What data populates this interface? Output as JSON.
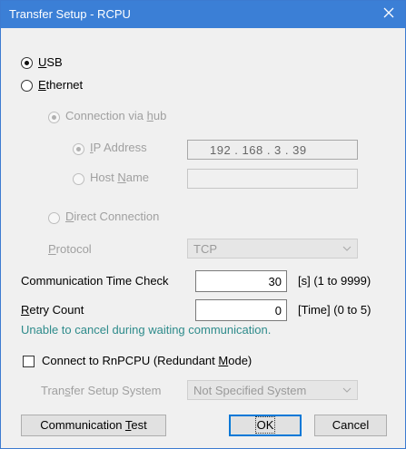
{
  "window": {
    "title": "Transfer Setup - RCPU"
  },
  "usb_label": "USB",
  "ethernet_label": "Ethernet",
  "via_hub_label": "Connection via hub",
  "ip_address_label": "IP Address",
  "ip_address_value": "192 . 168 .  3  .  39",
  "host_name_label": "Host Name",
  "host_name_value": "",
  "direct_connection_label": "Direct Connection",
  "protocol_label": "Protocol",
  "protocol_value": "TCP",
  "comm_time_check_label": "Communication Time Check",
  "comm_time_check_value": "30",
  "comm_time_check_unit": "[s]  (1 to 9999)",
  "retry_count_label": "Retry Count",
  "retry_count_value": "0",
  "retry_count_unit": "[Time]  (0 to 5)",
  "warning_text": "Unable to cancel during waiting communication.",
  "redundant_label": "Connect to RnPCPU (Redundant Mode)",
  "transfer_system_label": "Transfer Setup System",
  "transfer_system_value": "Not Specified System",
  "buttons": {
    "comm_test": "Communication Test",
    "ok": "OK",
    "cancel": "Cancel"
  },
  "state": {
    "usb_selected": true,
    "ethernet_selected": false,
    "via_hub_selected": true,
    "ip_address_selected": true,
    "redundant_checked": false
  },
  "colors": {
    "title_bar": "#3b7fd6",
    "note": "#2e8b8b",
    "default_button_border": "#0078d7"
  }
}
